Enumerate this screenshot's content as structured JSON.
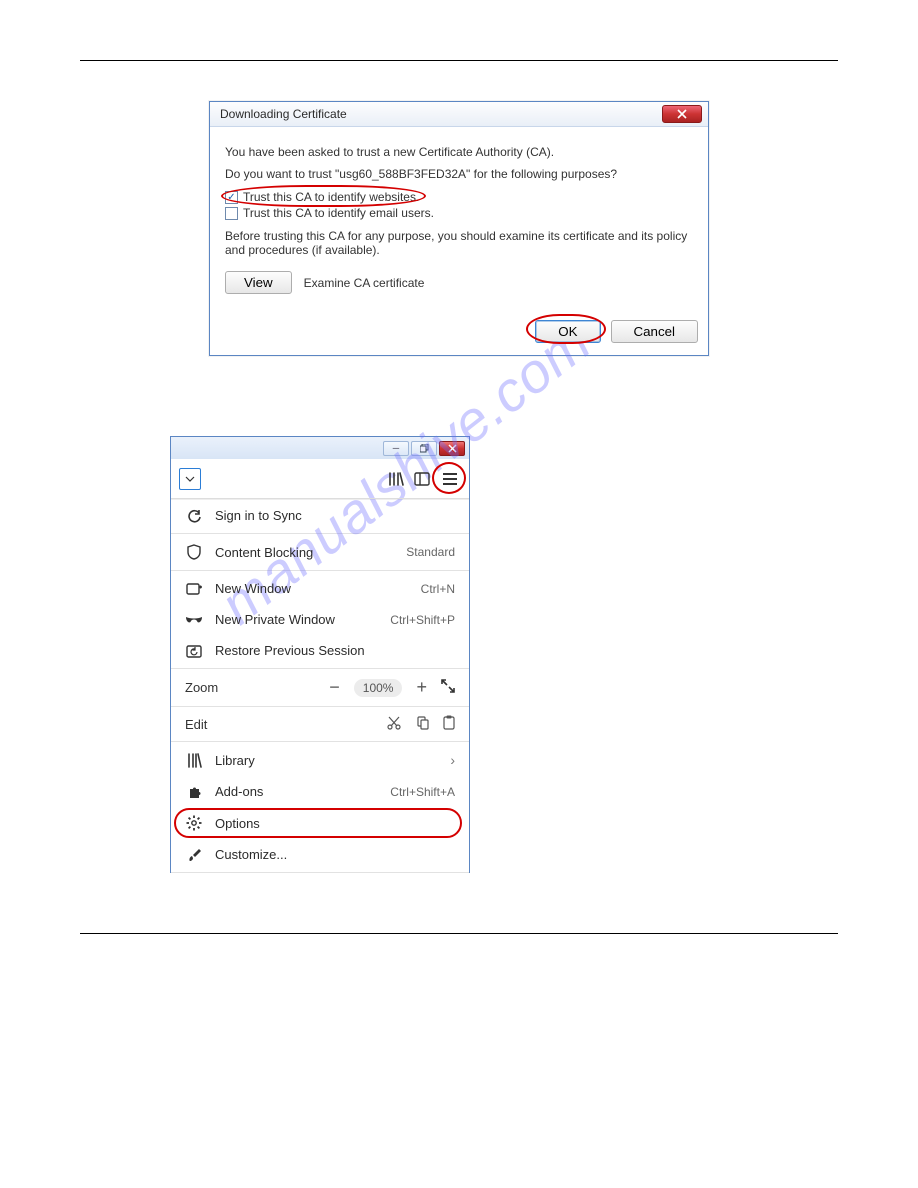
{
  "watermark": "manualshive.com",
  "dialog": {
    "title": "Downloading Certificate",
    "intro": "You have been asked to trust a new Certificate Authority (CA).",
    "question": "Do you want to trust \"usg60_588BF3FED32A\" for the following purposes?",
    "cb_websites": "Trust this CA to identify websites.",
    "cb_email": "Trust this CA to identify email users.",
    "warning": "Before trusting this CA for any purpose, you should examine its certificate and its policy and procedures (if available).",
    "view": "View",
    "view_note": "Examine CA certificate",
    "ok": "OK",
    "cancel": "Cancel"
  },
  "ffmenu": {
    "sign_in": "Sign in to Sync",
    "content_blocking": "Content Blocking",
    "content_blocking_status": "Standard",
    "new_window": "New Window",
    "new_window_accel": "Ctrl+N",
    "new_private": "New Private Window",
    "new_private_accel": "Ctrl+Shift+P",
    "restore": "Restore Previous Session",
    "zoom_label": "Zoom",
    "zoom_value": "100%",
    "edit_label": "Edit",
    "library": "Library",
    "addons": "Add-ons",
    "addons_accel": "Ctrl+Shift+A",
    "options": "Options",
    "customize": "Customize..."
  }
}
